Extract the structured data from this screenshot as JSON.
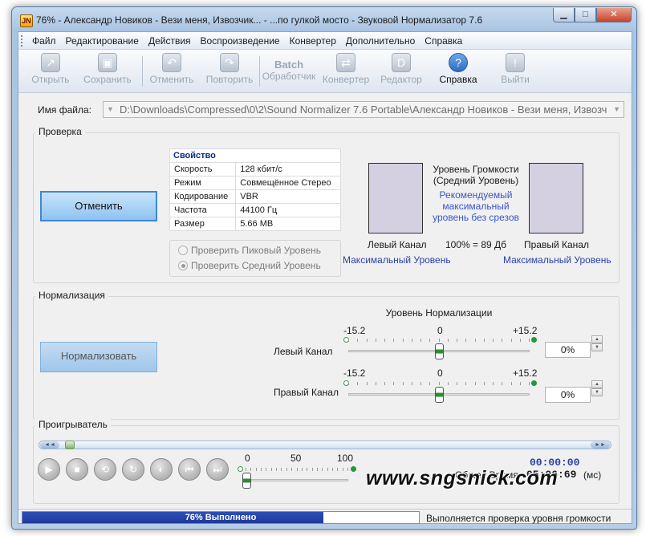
{
  "window": {
    "title": "76% - Александр Новиков - Вези меня, Извозчик... - ...по гулкой мосто - Звуковой Нормализатор 7.6",
    "icon_text": "JN",
    "minimize": "▁",
    "maximize": "□",
    "close": "✕"
  },
  "menu": [
    "Файл",
    "Редактирование",
    "Действия",
    "Воспроизведение",
    "Конвертер",
    "Дополнительно",
    "Справка"
  ],
  "toolbar": {
    "open": "Открыть",
    "save": "Сохранить",
    "undo": "Отменить",
    "redo": "Повторить",
    "batch_icon_word": "Batch",
    "batch": "Обработчик",
    "converter": "Конвертер",
    "editor": "Редактор",
    "help": "Справка",
    "exit": "Выйти"
  },
  "file": {
    "label": "Имя файла:",
    "path": "D:\\Downloads\\Compressed\\0\\2\\Sound Normalizer 7.6 Portable\\Александр Новиков - Вези меня, Извозч"
  },
  "check": {
    "group_title": "Проверка",
    "cancel_button": "Отменить",
    "props_header": "Свойство",
    "props": [
      {
        "key": "Скорость",
        "value": "128 кбит/с"
      },
      {
        "key": "Режим",
        "value": "Совмещённое Стерео"
      },
      {
        "key": "Кодирование",
        "value": "VBR"
      },
      {
        "key": "Частота",
        "value": "44100 Гц"
      },
      {
        "key": "Размер",
        "value": "5.66 MB"
      }
    ],
    "radio_peak": "Проверить Пиковый Уровень",
    "radio_avg": "Проверить Средний Уровень",
    "level_title_1": "Уровень Громкости",
    "level_title_2": "(Средний Уровень)",
    "recommended_1": "Рекомендуемый",
    "recommended_2": "максимальный",
    "recommended_3": "уровень без срезов",
    "left_channel": "Левый Канал",
    "right_channel": "Правый Канал",
    "percent_db": "100% = 89 Дб",
    "max_level_left": "Максимальный Уровень",
    "max_level_right": "Максимальный Уровень"
  },
  "normalization": {
    "group_title": "Нормализация",
    "button": "Нормализовать",
    "level_title": "Уровень Нормализации",
    "left_label": "Левый Канал",
    "right_label": "Правый Канал",
    "scale_min": "-15.2",
    "scale_mid": "0",
    "scale_max": "+15.2",
    "left_value": "0%",
    "right_value": "0%"
  },
  "player": {
    "group_title": "Проигрыватель",
    "seek_left_cap": "◄◄",
    "seek_right_cap": "►►",
    "buttons": [
      "play",
      "stop",
      "repeat",
      "refresh",
      "sound",
      "prev",
      "next"
    ],
    "volume_min": "0",
    "volume_mid": "50",
    "volume_max": "100",
    "current_time": "00:00:00",
    "total_label": "Общее Время:",
    "total_time": "05:06:69",
    "unit": "(мс)"
  },
  "watermark": "www.sngsnick.com",
  "status": {
    "progress_fraction": 0.76,
    "progress_text": "76% Выполнено",
    "message": "Выполняется проверка уровня громкости"
  },
  "colors": {
    "accent": "#3f86d8",
    "progress": "#1d3a99",
    "link": "#2b3fa8"
  }
}
